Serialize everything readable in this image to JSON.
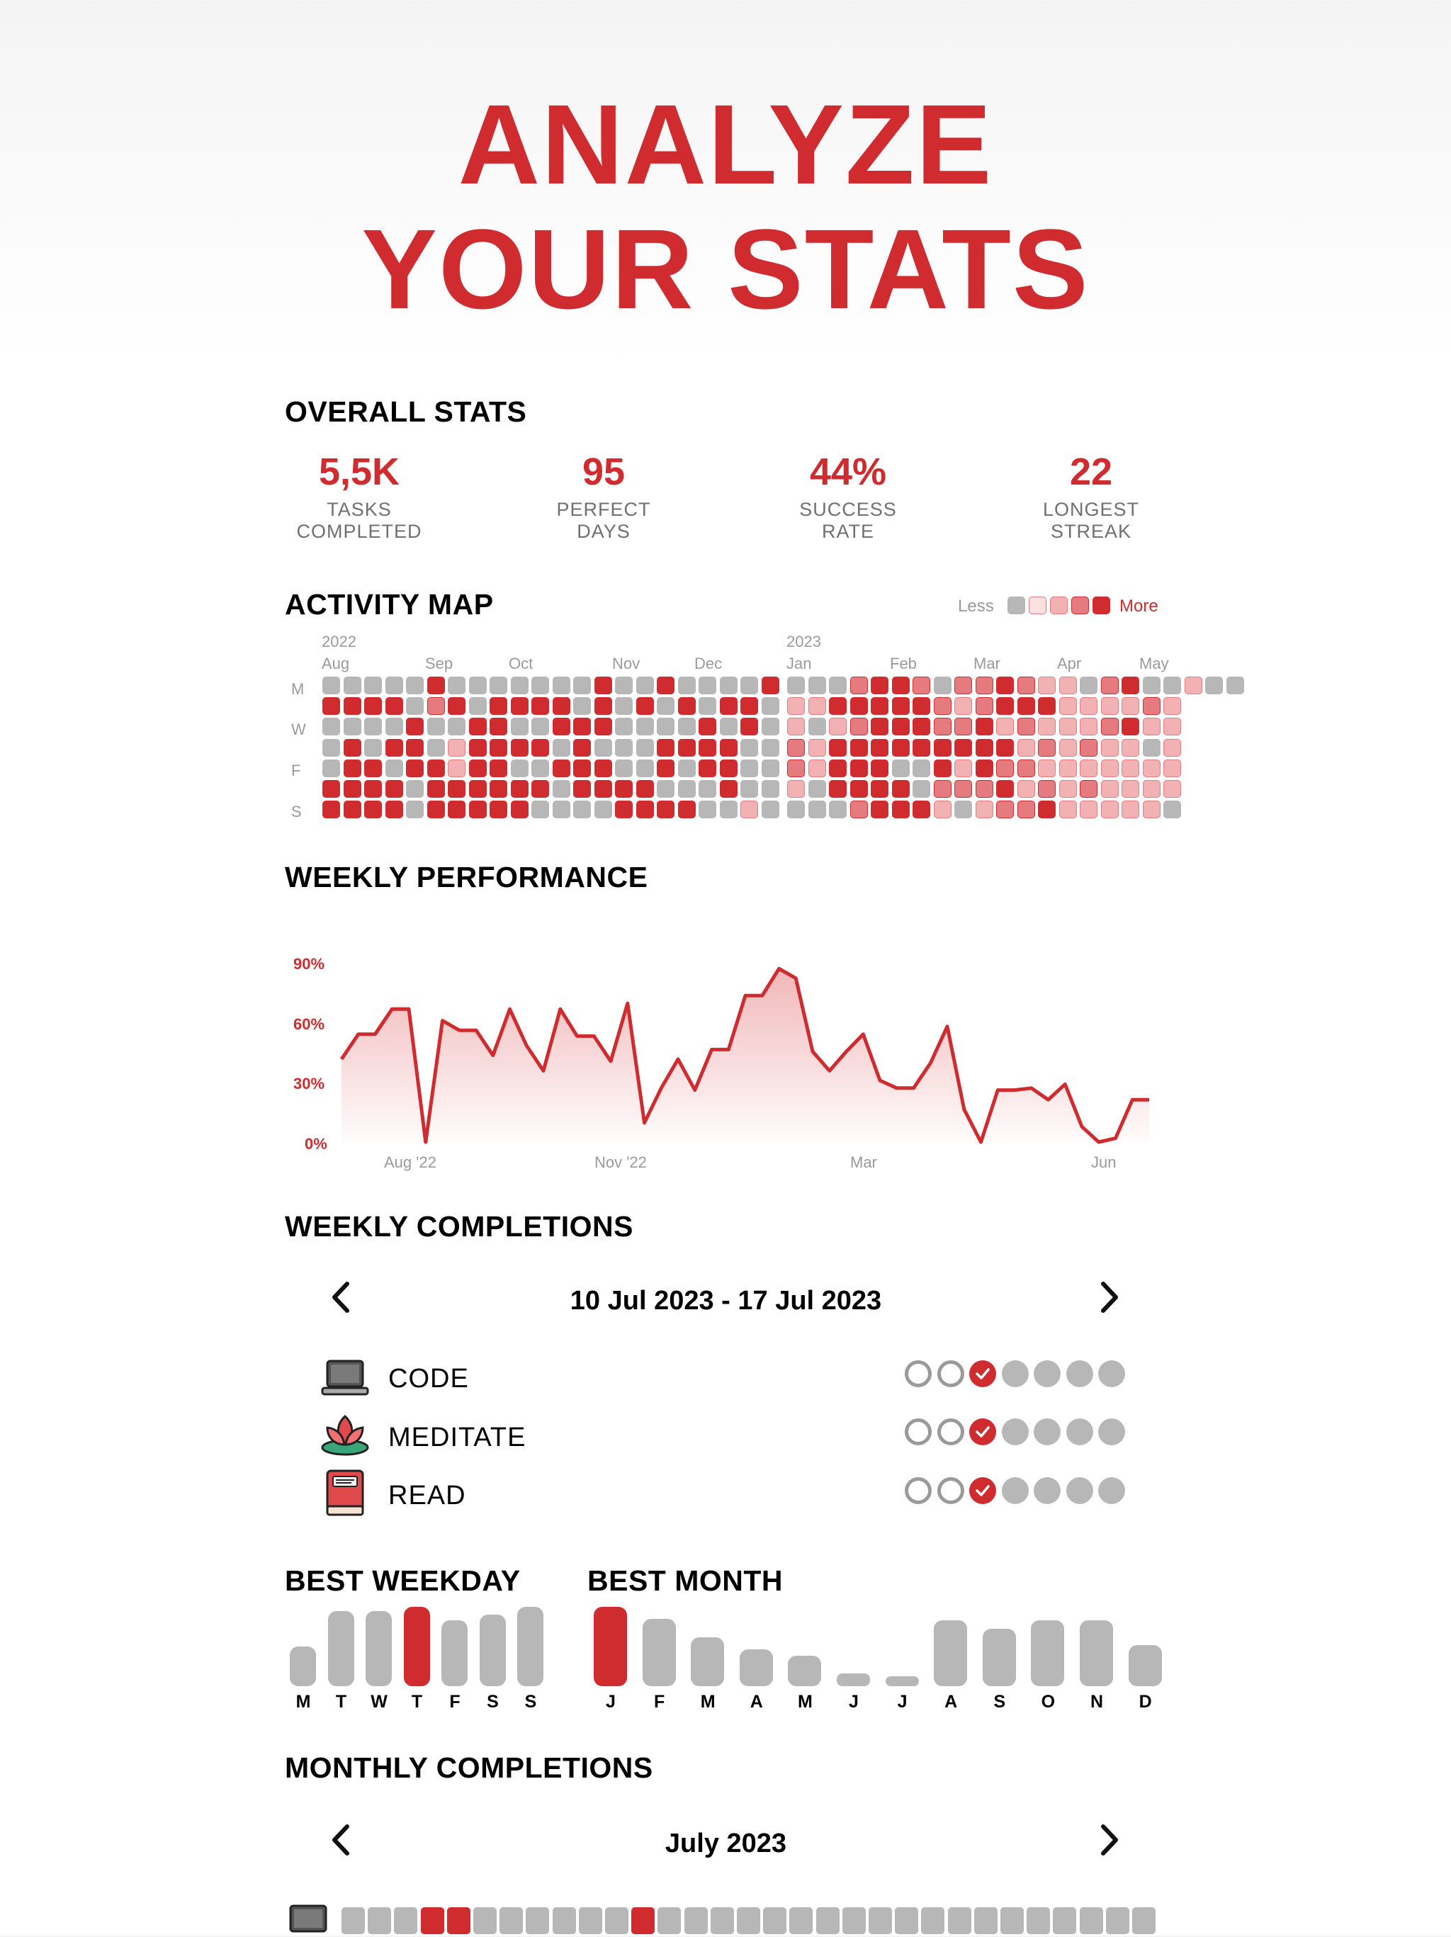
{
  "headline": {
    "line1": "ANALYZE",
    "line2": "YOUR STATS"
  },
  "colors": {
    "accent": "#d02b2f",
    "inactive": "#b7b7b7",
    "level_colors": [
      "#b7b7b7",
      "#fbe1e2",
      "#f2b1b3",
      "#e57b7e",
      "#d02b2f"
    ]
  },
  "overall": {
    "title": "OVERALL STATS",
    "stats": [
      {
        "value": "5,5K",
        "label": "TASKS\nCOMPLETED"
      },
      {
        "value": "95",
        "label": "PERFECT\nDAYS"
      },
      {
        "value": "44%",
        "label": "SUCCESS\nRATE"
      },
      {
        "value": "22",
        "label": "LONGEST\nSTREAK"
      }
    ]
  },
  "activity": {
    "title": "ACTIVITY MAP",
    "legend_less": "Less",
    "legend_more": "More",
    "year_labels": [
      "2022",
      "2023"
    ],
    "month_labels": [
      "Aug",
      "Sep",
      "Oct",
      "Nov",
      "Dec",
      "Jan",
      "Feb",
      "Mar",
      "Apr",
      "May"
    ],
    "day_labels": [
      "M",
      "W",
      "F",
      "S"
    ],
    "weeks_2022": 22,
    "weeks_2023": 19,
    "levels_2022": [
      "0000040000000400400004",
      "4444034044440404040440",
      "0000400440044400004040",
      "0404402444404000444400",
      "0440442440044400404400",
      "4444044444404444000400",
      "4444044444000044440020"
    ],
    "levels_2023": [
      "0003443033432203400200",
      "2244444323444222232",
      "2023444334232223422",
      "3244444444423232202",
      "3244400424332222222",
      "2044440333423232222",
      "0003444202334222220"
    ]
  },
  "weekly_performance": {
    "title": "WEEKLY PERFORMANCE"
  },
  "chart_data": {
    "type": "area",
    "ylabels": [
      "90%",
      "60%",
      "30%",
      "0%"
    ],
    "xlabels": [
      "Aug '22",
      "Nov '22",
      "Mar",
      "Jun"
    ],
    "ylim": [
      0,
      100
    ],
    "values": [
      43,
      56,
      56,
      69,
      69,
      0,
      63,
      58,
      58,
      45,
      69,
      50,
      37,
      69,
      55,
      55,
      42,
      72,
      10,
      28,
      43,
      27,
      48,
      48,
      76,
      76,
      90,
      85,
      47,
      37,
      47,
      56,
      32,
      28,
      28,
      41,
      60,
      17,
      0,
      27,
      27,
      28,
      22,
      30,
      8,
      0,
      2,
      22,
      22
    ]
  },
  "weekly_completions": {
    "title": "WEEKLY COMPLETIONS",
    "range": "10 Jul 2023 - 17 Jul 2023",
    "habits": [
      {
        "icon": "laptop-icon",
        "label": "CODE",
        "days": [
          "empty",
          "empty",
          "done",
          "future",
          "future",
          "future",
          "future"
        ]
      },
      {
        "icon": "lotus-icon",
        "label": "MEDITATE",
        "days": [
          "empty",
          "empty",
          "done",
          "future",
          "future",
          "future",
          "future"
        ]
      },
      {
        "icon": "book-icon",
        "label": "READ",
        "days": [
          "empty",
          "empty",
          "done",
          "future",
          "future",
          "future",
          "future"
        ]
      }
    ]
  },
  "best_weekday": {
    "title": "BEST WEEKDAY",
    "labels": [
      "M",
      "T",
      "W",
      "T",
      "F",
      "S",
      "S"
    ],
    "values": [
      0.5,
      0.95,
      0.95,
      1.0,
      0.83,
      0.9,
      1.0
    ],
    "best_index": 3
  },
  "best_month": {
    "title": "BEST MONTH",
    "labels": [
      "J",
      "F",
      "M",
      "A",
      "M",
      "J",
      "J",
      "A",
      "S",
      "O",
      "N",
      "D"
    ],
    "values": [
      1.0,
      0.85,
      0.62,
      0.46,
      0.38,
      0.16,
      0.1,
      0.83,
      0.72,
      0.83,
      0.83,
      0.52
    ],
    "best_index": 0
  },
  "monthly_completions": {
    "title": "MONTHLY COMPLETIONS",
    "month": "July 2023",
    "rows": [
      {
        "icon": "laptop-icon",
        "days": [
          0,
          0,
          0,
          1,
          1,
          0,
          0,
          0,
          0,
          0,
          0,
          1,
          0,
          0,
          0,
          0,
          0,
          0,
          0,
          0,
          0,
          0,
          0,
          0,
          0,
          0,
          0,
          0,
          0,
          0,
          0
        ]
      }
    ]
  }
}
